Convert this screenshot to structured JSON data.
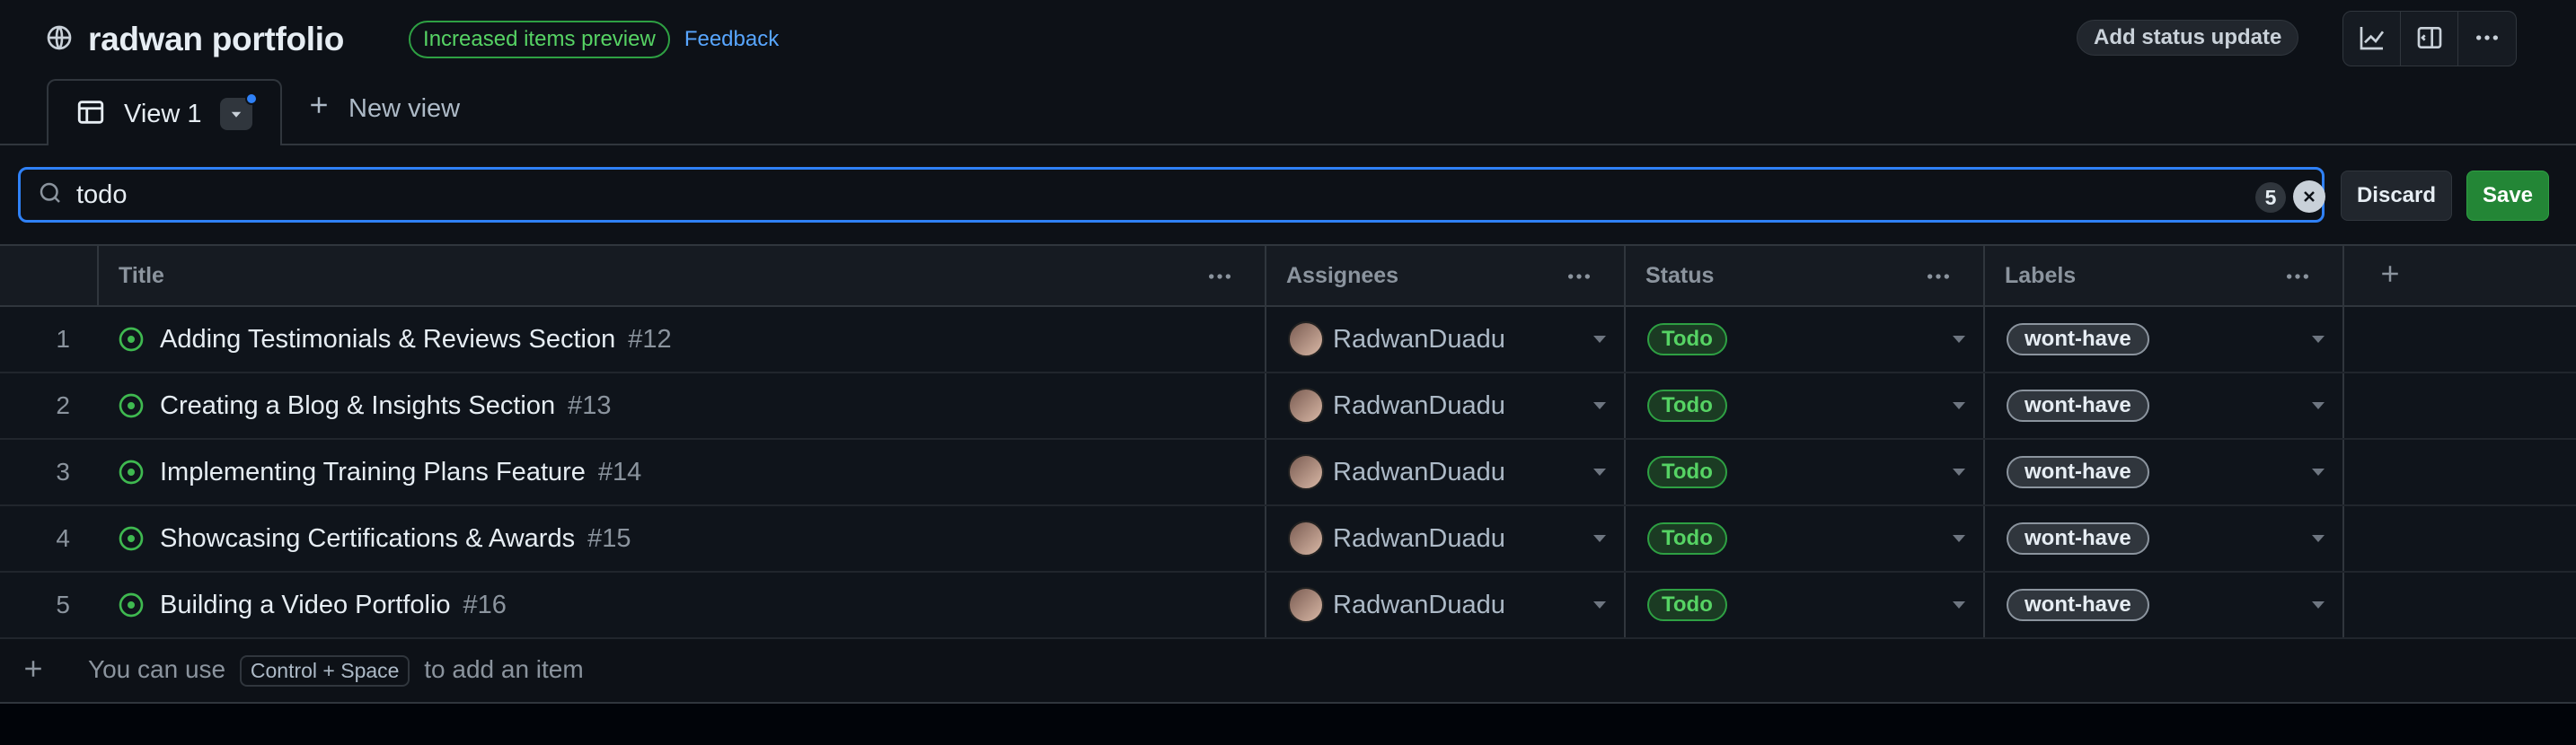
{
  "header": {
    "project_title": "radwan portfolio",
    "preview_pill": "Increased items preview",
    "feedback_link": "Feedback",
    "status_button": "Add status update"
  },
  "tabs": {
    "active_label": "View 1",
    "new_view_label": "New view"
  },
  "search": {
    "query": "todo",
    "result_count": "5",
    "discard_label": "Discard",
    "save_label": "Save"
  },
  "table": {
    "headers": [
      "Title",
      "Assignees",
      "Status",
      "Labels"
    ],
    "rows": [
      {
        "num": "1",
        "title": "Adding Testimonials & Reviews Section",
        "issue": "#12",
        "assignee": "RadwanDuadu",
        "status": "Todo",
        "label": "wont-have"
      },
      {
        "num": "2",
        "title": "Creating a Blog & Insights Section",
        "issue": "#13",
        "assignee": "RadwanDuadu",
        "status": "Todo",
        "label": "wont-have"
      },
      {
        "num": "3",
        "title": "Implementing Training Plans Feature",
        "issue": "#14",
        "assignee": "RadwanDuadu",
        "status": "Todo",
        "label": "wont-have"
      },
      {
        "num": "4",
        "title": "Showcasing Certifications & Awards",
        "issue": "#15",
        "assignee": "RadwanDuadu",
        "status": "Todo",
        "label": "wont-have"
      },
      {
        "num": "5",
        "title": "Building a Video Portfolio",
        "issue": "#16",
        "assignee": "RadwanDuadu",
        "status": "Todo",
        "label": "wont-have"
      }
    ]
  },
  "footer": {
    "prefix": "You can use",
    "shortcut": "Control + Space",
    "suffix": "to add an item"
  },
  "colors": {
    "accent": "#58a6ff",
    "focus_border": "#2f81f7",
    "status_green": "#3fb950",
    "save_green": "#238636"
  },
  "icons": [
    "globe-icon",
    "table-icon",
    "chevron-down-icon",
    "plus-icon",
    "search-icon",
    "clear-icon",
    "kebab-icon",
    "insights-icon",
    "panel-icon",
    "open-issue-icon"
  ]
}
